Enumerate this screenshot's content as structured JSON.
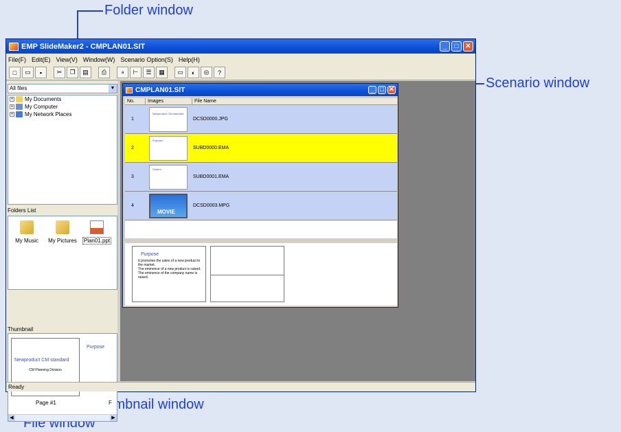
{
  "callouts": {
    "folder_window": "Folder window",
    "scenario_window": "Scenario window",
    "thumbnail_window": "Thumbnail window",
    "file_window": "File window"
  },
  "app": {
    "title": "EMP SlideMaker2 - CMPLAN01.SIT",
    "menu": [
      "File(F)",
      "Edit(E)",
      "View(V)",
      "Window(W)",
      "Scenario Option(S)",
      "Help(H)"
    ],
    "toolbar_icons": [
      "new-icon",
      "open-icon",
      "save-icon",
      "cut-icon",
      "copy-icon",
      "paste-icon",
      "print-icon",
      "text-icon",
      "tree-icon",
      "list-icon",
      "grid-icon",
      "monitor-icon",
      "run-icon",
      "web-icon",
      "help-icon"
    ],
    "status": "Ready"
  },
  "folder": {
    "combo_value": "All files",
    "tree": [
      "My Documents",
      "My Computer",
      "My Network Places"
    ]
  },
  "files": {
    "label": "Folders List",
    "items": [
      "My Music",
      "My Pictures",
      "Plan01.ppt"
    ]
  },
  "thumbnail": {
    "label": "Thumbnail",
    "slide1_title": "Newproduct CM standard",
    "slide1_sub": "CM Planning Division",
    "slide1_caption": "Page #1",
    "slide2_title": "Purpose",
    "slide2_caption": "F"
  },
  "scenario": {
    "title": "CMPLAN01.SIT",
    "columns": [
      "No.",
      "Images",
      "File Name"
    ],
    "rows": [
      {
        "no": "1",
        "file": "DCSD0000.JPG",
        "thumb": "Newproduct CM standard"
      },
      {
        "no": "2",
        "file": "SUBD0000.EMA",
        "thumb": "Purpose"
      },
      {
        "no": "3",
        "file": "SUBD0001.EMA",
        "thumb": "Outline"
      },
      {
        "no": "4",
        "file": "DCSD0003.MPG",
        "thumb": "MOVIE"
      }
    ],
    "preview": {
      "title": "Purpose",
      "bullets": [
        "It promotes the sales of a new product to the market.",
        "The eminence of a new product is raised.",
        "The eminence of the company name is raised."
      ]
    }
  },
  "colors": {
    "row_blue": "#c4d3f5",
    "row_selected": "#ffff00",
    "callout": "#1f3fd6"
  }
}
